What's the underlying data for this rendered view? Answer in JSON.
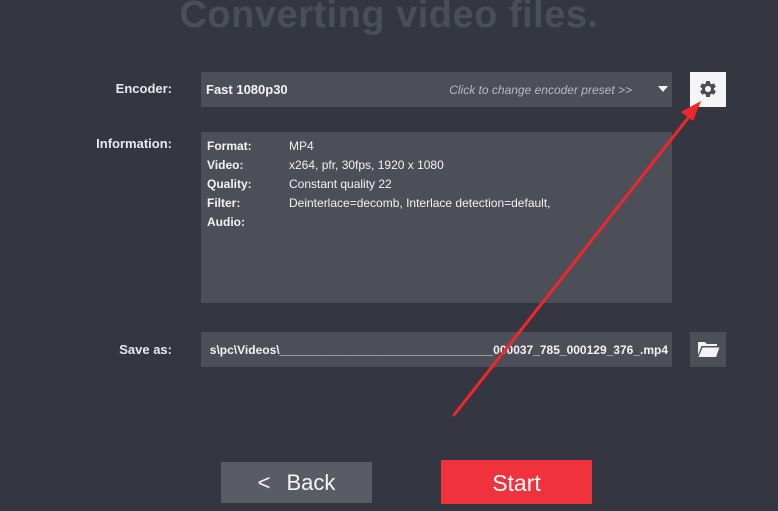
{
  "header": {
    "title": "Converting video files."
  },
  "encoder": {
    "label": "Encoder:",
    "value": "Fast 1080p30",
    "hint": "Click to change encoder preset >>"
  },
  "information": {
    "label": "Information:",
    "rows": [
      {
        "key": "Format:",
        "value": "MP4"
      },
      {
        "key": "Video:",
        "value": "x264, pfr, 30fps, 1920 x 1080"
      },
      {
        "key": "Quality:",
        "value": "Constant quality 22"
      },
      {
        "key": "Filter:",
        "value": "Deinterlace=decomb, Interlace detection=default,"
      },
      {
        "key": "Audio:",
        "value": ""
      }
    ]
  },
  "save_as": {
    "label": "Save as:",
    "path": "s\\pc\\Videos\\________________________________000037_785_000129_376_.mp4"
  },
  "buttons": {
    "back_chevron": "<",
    "back_label": "Back",
    "start_label": "Start"
  },
  "colors": {
    "background": "#343741",
    "panel": "#4c4f57",
    "start": "#f0323d",
    "annotation": "#f0262b"
  },
  "icons": {
    "settings": "gear-icon",
    "browse": "folder-icon",
    "annotation": "red-arrow"
  }
}
